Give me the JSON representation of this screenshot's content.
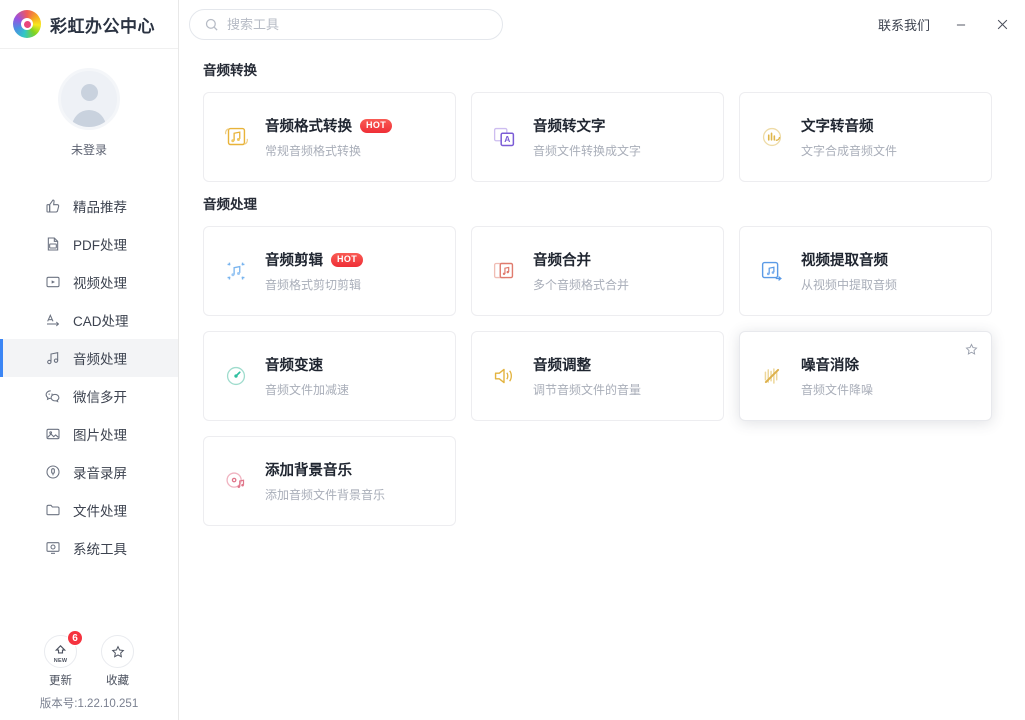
{
  "app": {
    "brand_name": "彩虹办公中心",
    "logo_icon": "rainbow-logo-icon"
  },
  "titlebar": {
    "contact_label": "联系我们",
    "minimize_icon": "minimize-icon",
    "close_icon": "close-icon"
  },
  "search": {
    "placeholder": "搜索工具",
    "value": "",
    "icon": "search-icon"
  },
  "sidebar": {
    "profile": {
      "label": "未登录",
      "avatar_icon": "user-avatar-icon"
    },
    "items": [
      {
        "label": "精品推荐",
        "icon": "thumbs-up-icon",
        "active": false
      },
      {
        "label": "PDF处理",
        "icon": "pdf-file-icon",
        "active": false
      },
      {
        "label": "视频处理",
        "icon": "video-play-icon",
        "active": false
      },
      {
        "label": "CAD处理",
        "icon": "cad-icon",
        "active": false
      },
      {
        "label": "音频处理",
        "icon": "music-note-icon",
        "active": true
      },
      {
        "label": "微信多开",
        "icon": "wechat-icon",
        "active": false
      },
      {
        "label": "图片处理",
        "icon": "image-icon",
        "active": false
      },
      {
        "label": "录音录屏",
        "icon": "microphone-record-icon",
        "active": false
      },
      {
        "label": "文件处理",
        "icon": "folder-icon",
        "active": false
      },
      {
        "label": "系统工具",
        "icon": "system-monitor-icon",
        "active": false
      }
    ],
    "actions": [
      {
        "label": "更新",
        "icon": "update-arrow-icon",
        "badge": "6",
        "sub": "NEW"
      },
      {
        "label": "收藏",
        "icon": "star-icon",
        "badge": "",
        "sub": ""
      }
    ],
    "version": "版本号:1.22.10.251"
  },
  "sections": [
    {
      "title": "音频转换",
      "cards": [
        {
          "title": "音频格式转换",
          "desc": "常规音频格式转换",
          "badge": "HOT",
          "icon": "audio-format-convert-icon",
          "color": "#e8b33a",
          "selected": false,
          "starred": false
        },
        {
          "title": "音频转文字",
          "desc": "音频文件转换成文字",
          "badge": "",
          "icon": "audio-to-text-icon",
          "color": "#7b5cd6",
          "selected": false,
          "starred": false
        },
        {
          "title": "文字转音频",
          "desc": "文字合成音频文件",
          "badge": "",
          "icon": "text-to-audio-icon",
          "color": "#e0b64a",
          "selected": false,
          "starred": false
        }
      ]
    },
    {
      "title": "音频处理",
      "cards": [
        {
          "title": "音频剪辑",
          "desc": "音频格式剪切剪辑",
          "badge": "HOT",
          "icon": "audio-cut-icon",
          "color": "#7ab5ef",
          "selected": false,
          "starred": false
        },
        {
          "title": "音频合并",
          "desc": "多个音频格式合并",
          "badge": "",
          "icon": "audio-merge-icon",
          "color": "#e07b6e",
          "selected": false,
          "starred": false
        },
        {
          "title": "视频提取音频",
          "desc": "从视频中提取音频",
          "badge": "",
          "icon": "video-extract-audio-icon",
          "color": "#5a9ae6",
          "selected": false,
          "starred": false
        },
        {
          "title": "音频变速",
          "desc": "音频文件加减速",
          "badge": "",
          "icon": "audio-speed-icon",
          "color": "#2fbfa0",
          "selected": false,
          "starred": false
        },
        {
          "title": "音频调整",
          "desc": "调节音频文件的音量",
          "badge": "",
          "icon": "volume-adjust-icon",
          "color": "#e3b33f",
          "selected": false,
          "starred": false
        },
        {
          "title": "噪音消除",
          "desc": "音频文件降噪",
          "badge": "",
          "icon": "noise-reduction-icon",
          "color": "#ddb04a",
          "selected": true,
          "starred": true
        },
        {
          "title": "添加背景音乐",
          "desc": "添加音频文件背景音乐",
          "badge": "",
          "icon": "background-music-icon",
          "color": "#e0758a",
          "selected": false,
          "starred": false
        }
      ]
    }
  ],
  "theme": {
    "accent": "#3c86f5",
    "badge_red": "#f5333f",
    "text_primary": "#1f2530",
    "text_muted": "#a9aeb9"
  }
}
